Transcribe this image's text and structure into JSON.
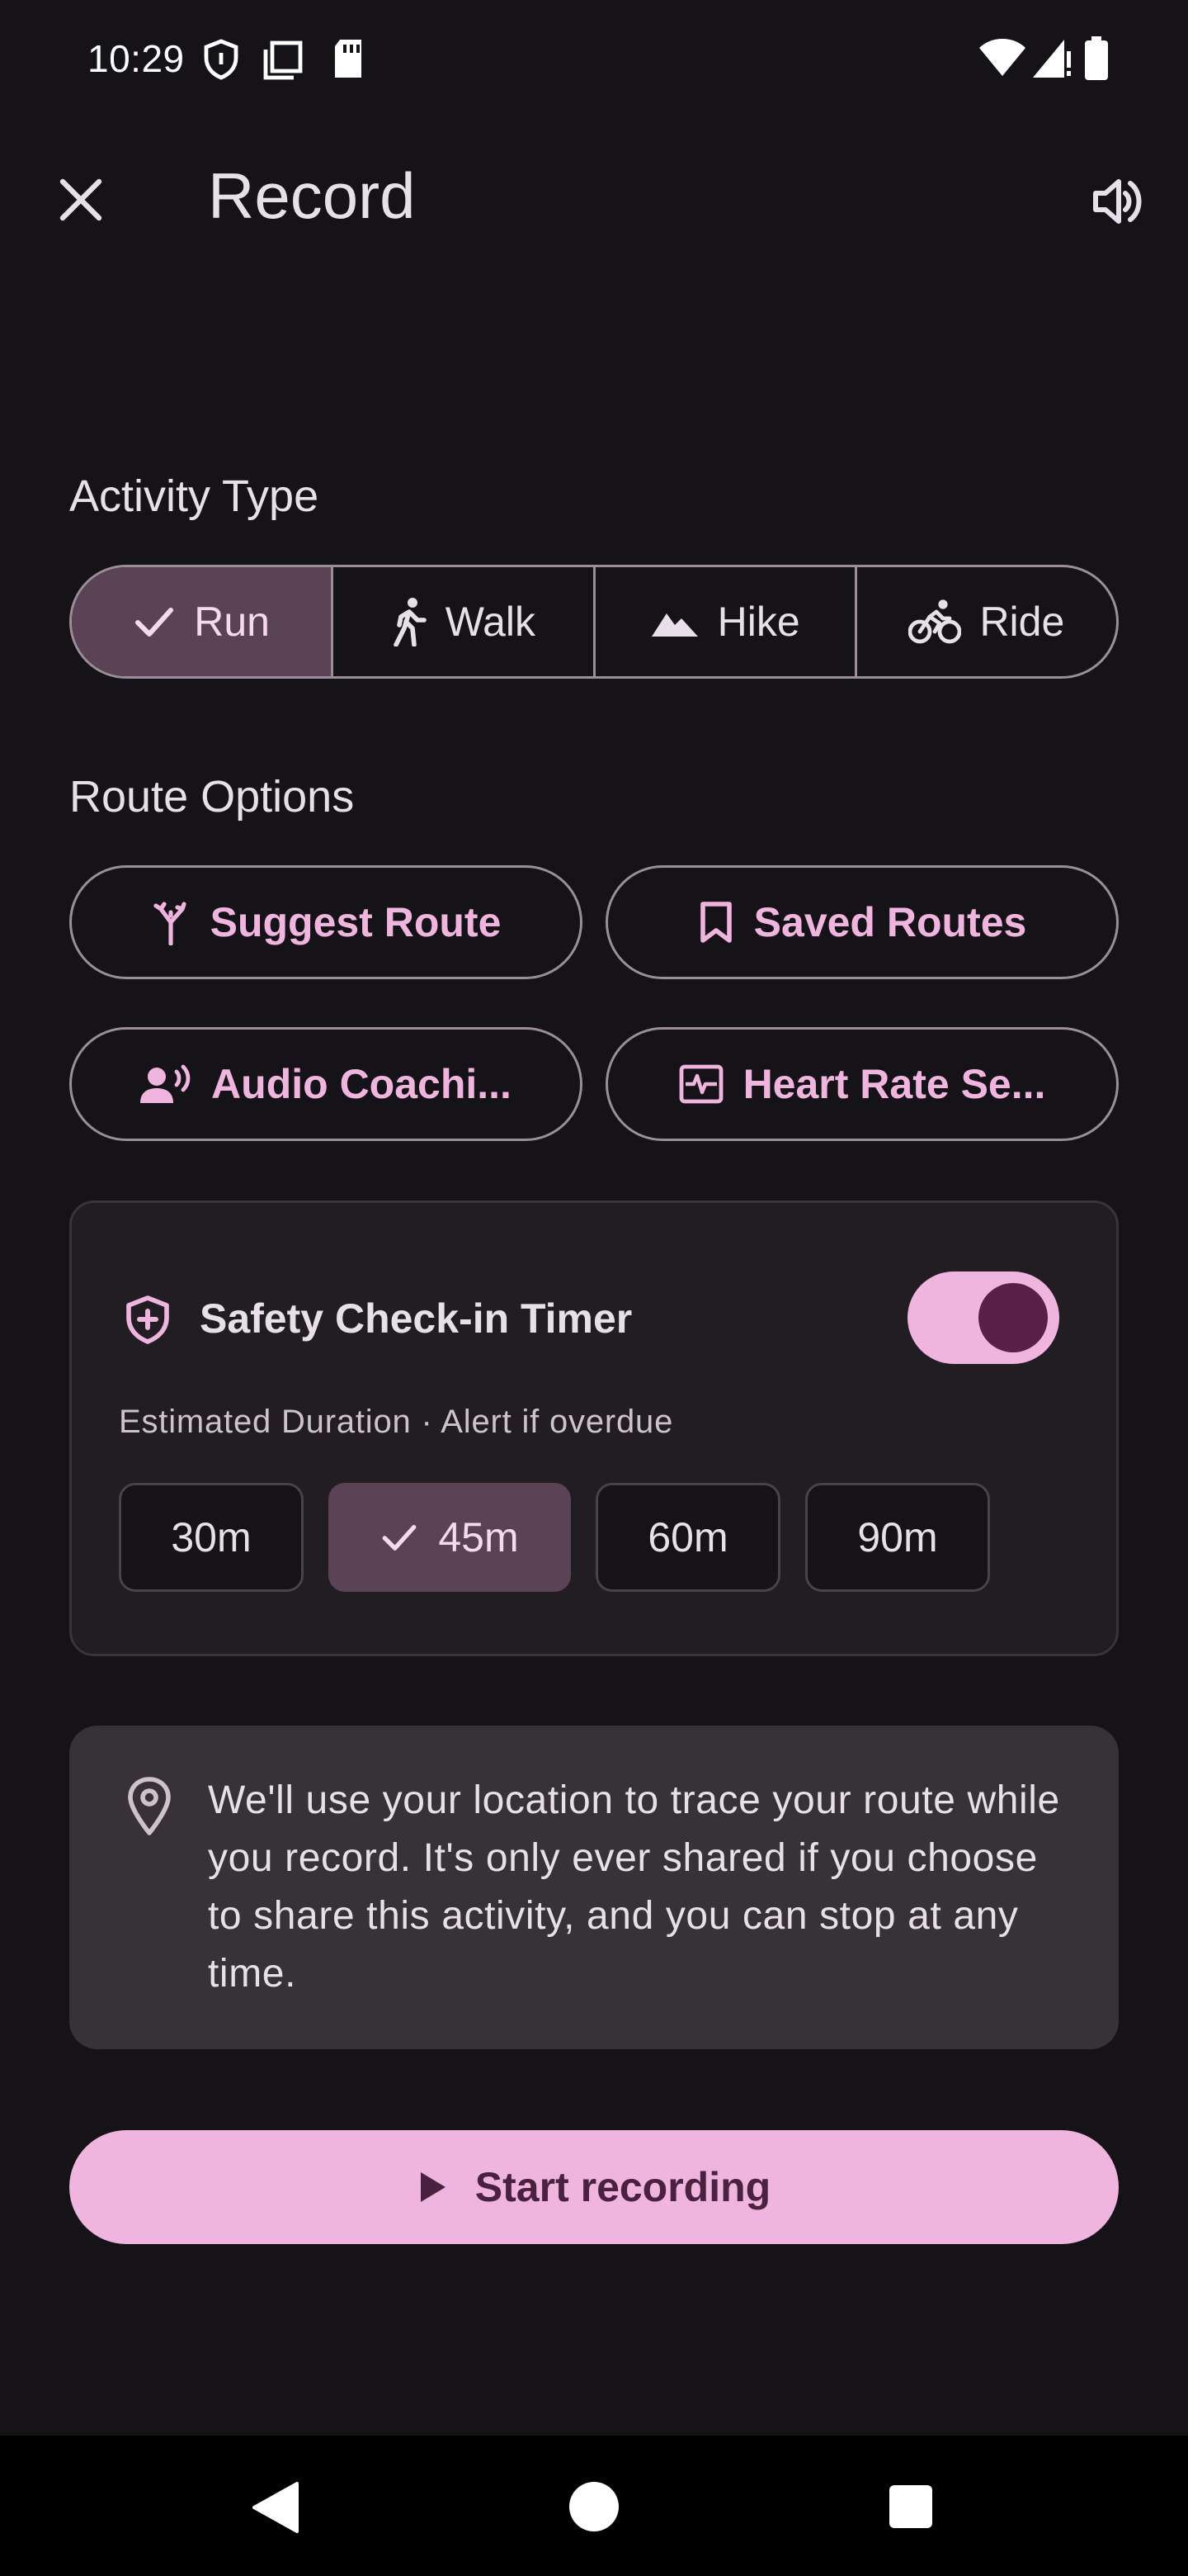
{
  "status_bar": {
    "time": "10:29"
  },
  "app_bar": {
    "title": "Record"
  },
  "activity_type": {
    "title": "Activity Type",
    "options": [
      {
        "label": "Run",
        "icon": "check-icon",
        "selected": true
      },
      {
        "label": "Walk",
        "icon": "walk-icon",
        "selected": false
      },
      {
        "label": "Hike",
        "icon": "mountain-icon",
        "selected": false
      },
      {
        "label": "Ride",
        "icon": "bike-icon",
        "selected": false
      }
    ]
  },
  "route_options": {
    "title": "Route Options",
    "buttons": [
      {
        "label": "Suggest Route",
        "icon": "route-icon"
      },
      {
        "label": "Saved Routes",
        "icon": "bookmark-icon"
      },
      {
        "label": "Audio Coachi...",
        "icon": "voice-icon"
      },
      {
        "label": "Heart Rate Se...",
        "icon": "heart-rate-icon"
      }
    ]
  },
  "safety": {
    "title": "Safety Check-in Timer",
    "subtitle": "Estimated Duration · Alert if overdue",
    "enabled": true,
    "durations": [
      {
        "label": "30m",
        "selected": false
      },
      {
        "label": "45m",
        "selected": true
      },
      {
        "label": "60m",
        "selected": false
      },
      {
        "label": "90m",
        "selected": false
      }
    ]
  },
  "location_info": {
    "text": "We'll use your location to trace your route while you record. It's only ever shared if you choose to share this activity, and you can stop at any time."
  },
  "start_button": {
    "label": "Start recording"
  },
  "colors": {
    "background": "#151218",
    "accent": "#F0B5DF",
    "selected_segment": "#5A4354",
    "outline": "#9A8F98"
  }
}
